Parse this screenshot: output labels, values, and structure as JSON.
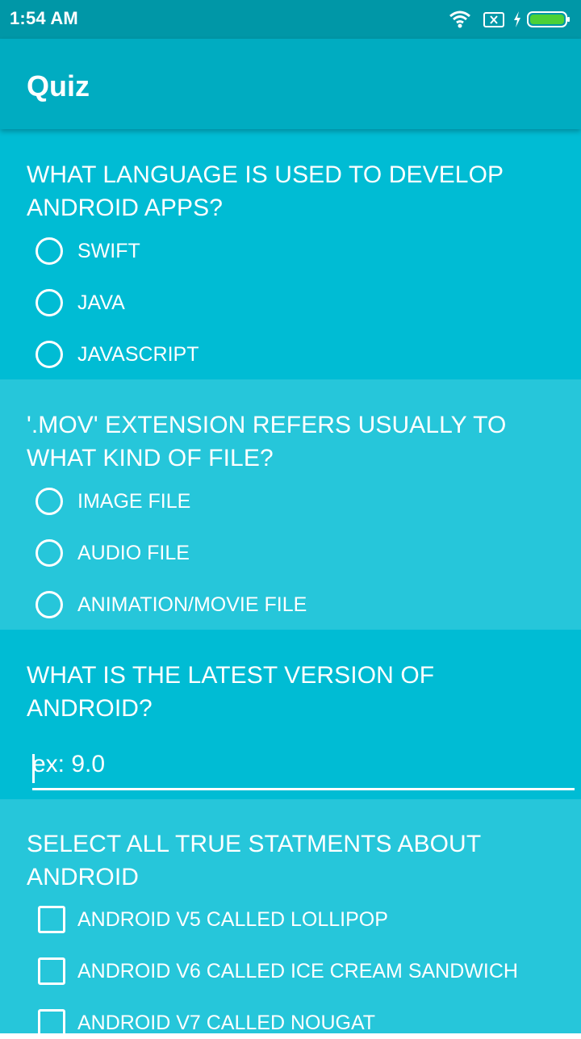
{
  "status_bar": {
    "time": "1:54 AM",
    "icons": [
      "wifi-icon",
      "no-sim-icon",
      "charging-icon",
      "battery-icon"
    ],
    "battery_color": "#4CD137"
  },
  "app_bar": {
    "title": "Quiz",
    "color": "#00ACC1"
  },
  "questions": [
    {
      "text": "WHAT LANGUAGE IS USED TO DEVELOP ANDROID APPS?",
      "type": "radio",
      "options": [
        "SWIFT",
        "JAVA",
        "JAVASCRIPT"
      ]
    },
    {
      "text": "'.MOV' EXTENSION REFERS USUALLY TO WHAT KIND OF FILE?",
      "type": "radio",
      "options": [
        "IMAGE FILE",
        "AUDIO FILE",
        "ANIMATION/MOVIE FILE"
      ]
    },
    {
      "text": "WHAT IS THE LATEST VERSION OF ANDROID?",
      "type": "text",
      "value": "",
      "placeholder": "ex: 9.0"
    },
    {
      "text": "SELECT ALL TRUE STATMENTS ABOUT ANDROID",
      "type": "checkbox",
      "options": [
        "ANDROID V5 CALLED LOLLIPOP",
        "ANDROID V6 CALLED ICE CREAM SANDWICH",
        "ANDROID V7 CALLED NOUGAT"
      ]
    }
  ],
  "colors": {
    "section_dark": "#00BCD4",
    "section_light": "#26C6DA",
    "status_bar": "#0097A7"
  }
}
